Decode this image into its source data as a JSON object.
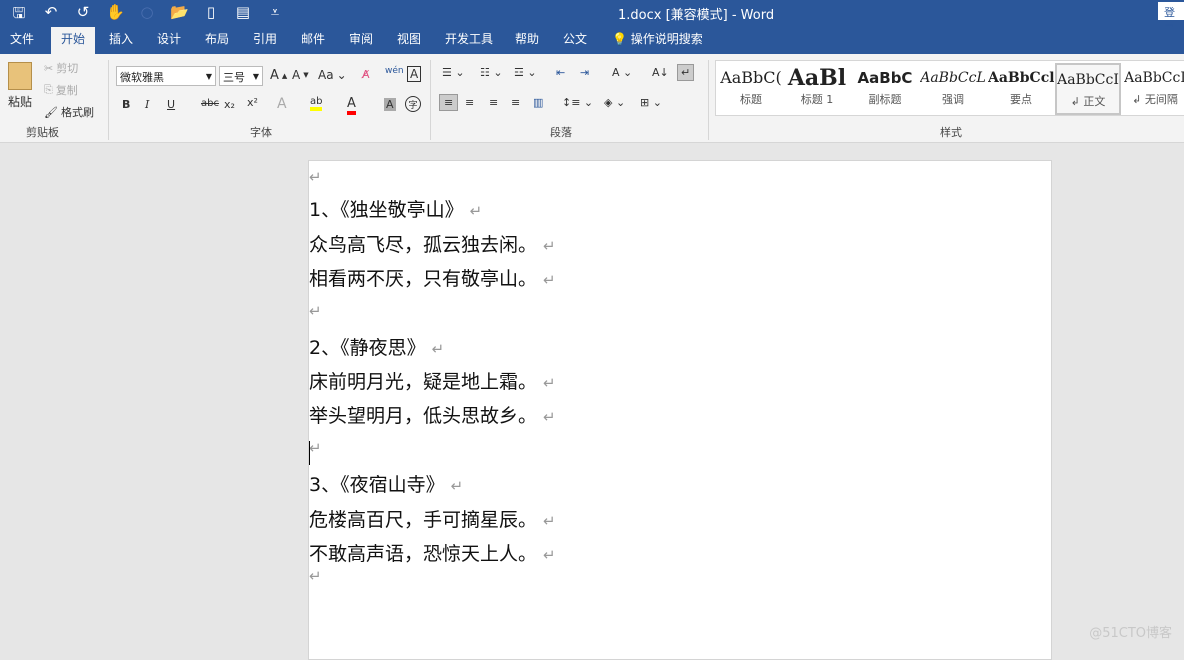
{
  "title": "1.docx [兼容模式]  -  Word",
  "login": "登录",
  "qat": [
    "save-icon",
    "undo-icon",
    "redo-icon",
    "touch-icon",
    "circle-icon",
    "open-icon",
    "new-icon",
    "print-icon",
    "customize-icon"
  ],
  "tabs": [
    "文件",
    "开始",
    "插入",
    "设计",
    "布局",
    "引用",
    "邮件",
    "审阅",
    "视图",
    "开发工具",
    "帮助",
    "公文"
  ],
  "tell_me": "操作说明搜索",
  "clipboard": {
    "paste": "粘贴",
    "cut": "剪切",
    "copy": "复制",
    "format_painter": "格式刷",
    "label": "剪贴板"
  },
  "font": {
    "name": "微软雅黑",
    "size": "三号",
    "label": "字体",
    "change_case": "Aa",
    "bold": "B",
    "italic": "I",
    "underline": "U",
    "strike": "abc",
    "sub": "x₂",
    "sup": "x²",
    "highlight_color": "#ffff00",
    "font_color": "#ff0000"
  },
  "paragraph": {
    "label": "段落"
  },
  "styles": {
    "label": "样式",
    "items": [
      {
        "sample": "AaBbC(",
        "label": "标题"
      },
      {
        "sample": "AaBl",
        "label": "标题 1"
      },
      {
        "sample": "AaBbC",
        "label": "副标题"
      },
      {
        "sample": "AaBbCcL",
        "label": "强调"
      },
      {
        "sample": "AaBbCcl",
        "label": "要点"
      },
      {
        "sample": "AaBbCcI",
        "label": "↲ 正文",
        "selected": true
      },
      {
        "sample": "AaBbCcI",
        "label": "↲ 无间隔"
      }
    ]
  },
  "document": {
    "pilcrow": "↵",
    "lines": [
      "",
      "1、《独坐敬亭山》",
      "众鸟高飞尽，孤云独去闲。",
      "相看两不厌，只有敬亭山。",
      "",
      "2、《静夜思》",
      "床前明月光，疑是地上霜。",
      "举头望明月，低头思故乡。",
      "",
      "3、《夜宿山寺》",
      "危楼高百尺，手可摘星辰。",
      "不敢高声语，恐惊天上人。",
      ""
    ]
  },
  "watermark": "@51CTO博客"
}
